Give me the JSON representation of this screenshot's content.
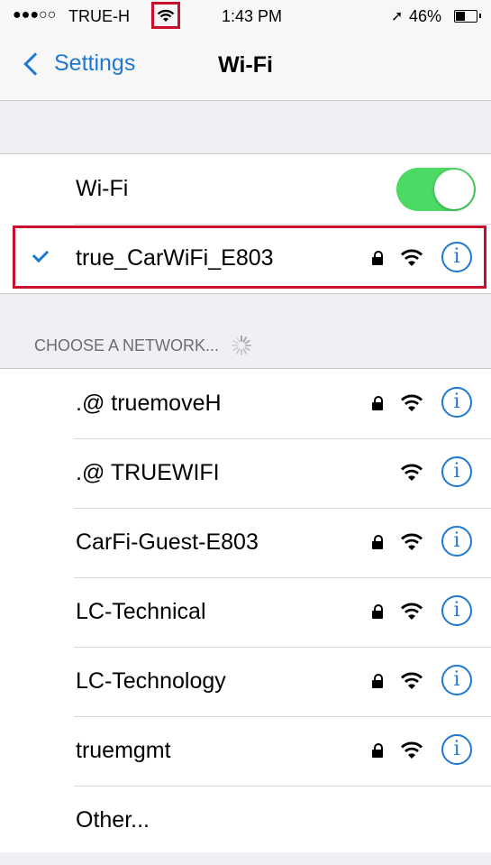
{
  "status_bar": {
    "signal": "●●●○○",
    "carrier": "TRUE-H",
    "time": "1:43 PM",
    "location_icon": "location-arrow-icon",
    "battery_percent": "46%",
    "battery_level": 0.46
  },
  "nav": {
    "back_label": "Settings",
    "title": "Wi-Fi"
  },
  "wifi_toggle": {
    "label": "Wi-Fi",
    "on": true
  },
  "connected_network": {
    "name": "true_CarWiFi_E803",
    "secured": true
  },
  "section_header": "CHOOSE A NETWORK...",
  "networks": [
    {
      "name": ".@  truemoveH",
      "secured": true
    },
    {
      "name": ".@  TRUEWIFI",
      "secured": false
    },
    {
      "name": "CarFi-Guest-E803",
      "secured": true
    },
    {
      "name": "LC-Technical",
      "secured": true
    },
    {
      "name": "LC-Technology",
      "secured": true
    },
    {
      "name": "truemgmt",
      "secured": true
    },
    {
      "name": "Other...",
      "other": true
    }
  ],
  "info_glyph": "i",
  "colors": {
    "accent": "#1f78d1",
    "toggle_on": "#4cd964",
    "highlight": "#c8102e"
  }
}
